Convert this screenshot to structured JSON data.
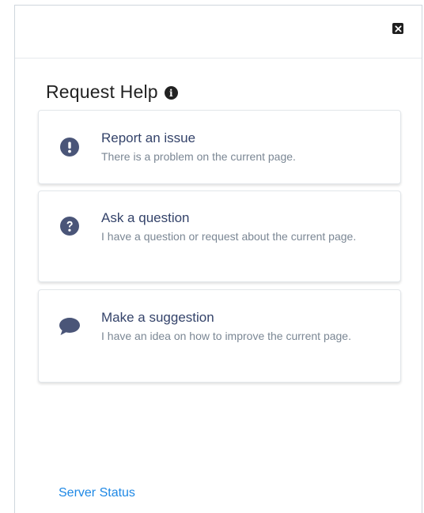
{
  "dialog": {
    "title": "Request Help",
    "close_icon": "close-icon",
    "info_icon": "info-icon"
  },
  "options": [
    {
      "heading": "Report an issue",
      "description": "There is a problem on the current page.",
      "icon": "exclamation-circle-icon"
    },
    {
      "heading": "Ask a question",
      "description": "I have a question or request about the current page.",
      "icon": "question-circle-icon"
    },
    {
      "heading": "Make a suggestion",
      "description": "I have an idea on how to improve the current page.",
      "icon": "comment-icon"
    }
  ],
  "footer": {
    "link_label": "Server Status"
  },
  "colors": {
    "icon": "#4a5578",
    "heading": "#34436a",
    "description": "#7b8794",
    "link": "#1e88e5"
  }
}
